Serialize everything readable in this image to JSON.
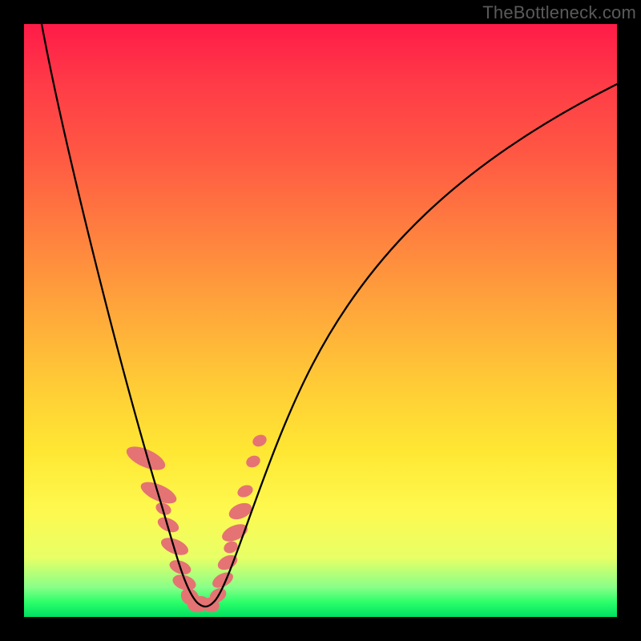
{
  "watermark": "TheBottleneck.com",
  "colors": {
    "background": "#000000",
    "gradient_top": "#ff1b48",
    "gradient_mid": "#ffe733",
    "gradient_bottom": "#00e060",
    "curve": "#000000",
    "marker": "#e57373"
  },
  "chart_data": {
    "type": "line",
    "title": "",
    "xlabel": "",
    "ylabel": "",
    "xlim": [
      0,
      100
    ],
    "ylim": [
      0,
      100
    ],
    "series": [
      {
        "name": "bottleneck-curve",
        "x": [
          3,
          6,
          10,
          14,
          17,
          19,
          21,
          23,
          25,
          26.5,
          28,
          30,
          31.5,
          32.5,
          33.5,
          36,
          40,
          45,
          52,
          60,
          70,
          82,
          95,
          100
        ],
        "y": [
          100,
          85,
          68,
          52,
          40,
          32,
          25,
          17,
          10,
          5,
          3,
          2,
          2.5,
          4,
          7,
          14,
          26,
          39,
          52,
          63,
          73,
          82,
          88,
          90
        ]
      }
    ],
    "annotations": {
      "marker_clusters": [
        {
          "side": "left",
          "x_range": [
            20,
            27
          ],
          "y_range": [
            4,
            27
          ]
        },
        {
          "side": "bottom",
          "x_range": [
            27,
            31
          ],
          "y_range": [
            2,
            3
          ]
        },
        {
          "side": "right",
          "x_range": [
            32,
            37
          ],
          "y_range": [
            4,
            29
          ]
        }
      ]
    }
  }
}
